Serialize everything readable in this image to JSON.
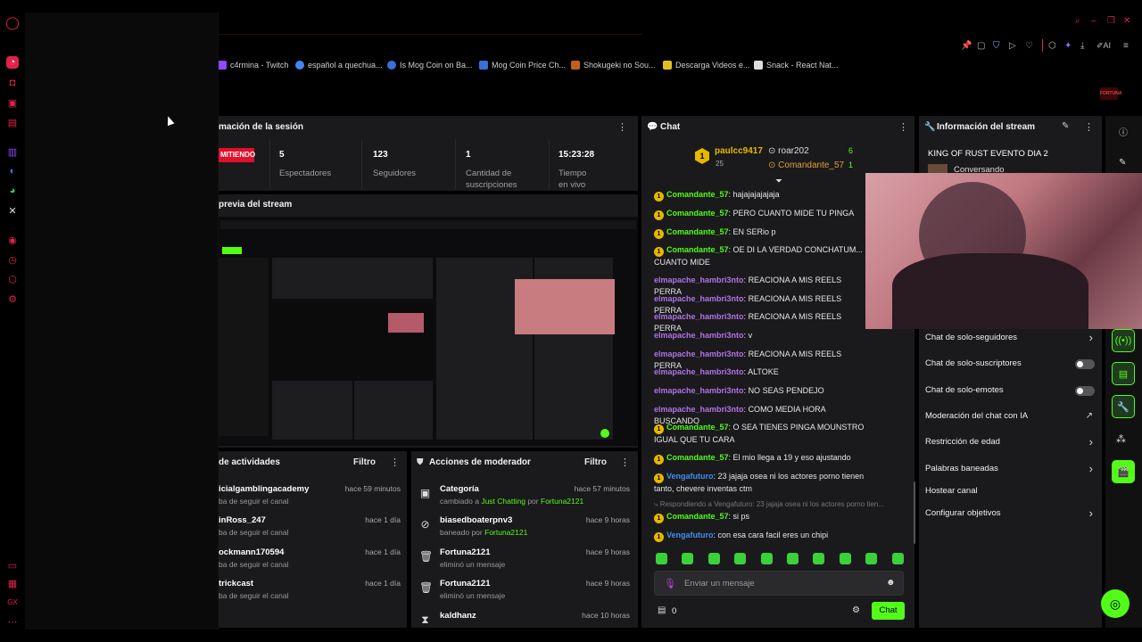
{
  "bookmarks": [
    {
      "label": "c4rmina - Twitch",
      "color": "#9146ff"
    },
    {
      "label": "español a quechua...",
      "color": "#4285f4"
    },
    {
      "label": "Is Mog Coin on Ba...",
      "color": "#3b6fd8"
    },
    {
      "label": "Mog Coin Price Ch...",
      "color": "#3b6fd8"
    },
    {
      "label": "Shokugeki no Sou...",
      "color": "#c06020"
    },
    {
      "label": "Descarga Videos e...",
      "color": "#e0c020"
    },
    {
      "label": "Snack - React Nat...",
      "color": "#dddddd"
    }
  ],
  "brand_badge": "FORTUNA",
  "session": {
    "title": "mación de la sesión",
    "live_badge": "MITIENDO",
    "stats": [
      {
        "value": "5",
        "label": "Espectadores"
      },
      {
        "value": "123",
        "label": "Seguidores"
      },
      {
        "value": "1",
        "label": "Cantidad de suscripciones"
      },
      {
        "value": "15:23:28",
        "label": "Tiempo en vivo"
      }
    ]
  },
  "preview": {
    "title": "previa del stream"
  },
  "activity": {
    "title": "de actividades",
    "filter": "Filtro",
    "rows": [
      {
        "name": "icialgamblingacademy",
        "sub": "ba de seguir el canal",
        "time": "hace 59 minutos"
      },
      {
        "name": "inRoss_247",
        "sub": "ba de seguir el canal",
        "time": "hace 1 día"
      },
      {
        "name": "ockmann170594",
        "sub": "ba de seguir el canal",
        "time": "hace 1 día"
      },
      {
        "name": "trickcast",
        "sub": "ba de seguir el canal",
        "time": "hace 1 día"
      }
    ]
  },
  "modactions": {
    "title": "Acciones de moderador",
    "filter": "Filtro",
    "rows": [
      {
        "icon": "category-icon",
        "name": "Categoría",
        "sub_pre": "cambiado a",
        "hl1": "Just Chatting",
        "mid": "por",
        "hl2": "Fortuna2121",
        "time": "hace 57 minutos"
      },
      {
        "icon": "ban-icon",
        "name": "biasedboaterpnv3",
        "sub_pre": "baneado por",
        "hl1": "Fortuna2121",
        "mid": "",
        "hl2": "",
        "time": "hace 9 horas"
      },
      {
        "icon": "trash-icon",
        "name": "Fortuna2121",
        "sub_pre": "eliminó un mensaje",
        "hl1": "",
        "mid": "",
        "hl2": "",
        "time": "hace 9 horas"
      },
      {
        "icon": "trash-icon",
        "name": "Fortuna2121",
        "sub_pre": "eliminó un mensaje",
        "hl1": "",
        "mid": "",
        "hl2": "",
        "time": "hace 9 horas"
      },
      {
        "icon": "hourglass-icon",
        "name": "kaldhanz",
        "sub_pre": "",
        "hl1": "",
        "mid": "",
        "hl2": "",
        "time": "hace 10 horas"
      }
    ]
  },
  "chat": {
    "title": "Chat",
    "leaderboard": {
      "first": {
        "rank": "1",
        "name": "paulcc9417",
        "count": "25"
      },
      "others": [
        {
          "name": "roar202",
          "count": "6"
        },
        {
          "name": "Comandante_57",
          "count": "1"
        }
      ]
    },
    "messages": [
      {
        "badge": true,
        "user": "Comandante_57",
        "color": "#53fc18",
        "text": "hajajajajajaja"
      },
      {
        "badge": true,
        "user": "Comandante_57",
        "color": "#53fc18",
        "text": "PERO CUANTO MIDE TU PINGA"
      },
      {
        "badge": true,
        "user": "Comandante_57",
        "color": "#53fc18",
        "text": "EN SERio p"
      },
      {
        "badge": true,
        "user": "Comandante_57",
        "color": "#53fc18",
        "text": "OE DI LA VERDAD CONCHATUM... CUANTO MIDE"
      },
      {
        "badge": false,
        "user": "elmapache_hambri3nto",
        "color": "#b072e8",
        "text": "REACIONA A MIS REELS PERRA"
      },
      {
        "badge": false,
        "user": "elmapache_hambri3nto",
        "color": "#b072e8",
        "text": "REACIONA A MIS REELS PERRA"
      },
      {
        "badge": false,
        "user": "elmapache_hambri3nto",
        "color": "#b072e8",
        "text": "REACIONA A MIS REELS PERRA"
      },
      {
        "badge": false,
        "user": "elmapache_hambri3nto",
        "color": "#b072e8",
        "text": "v"
      },
      {
        "badge": false,
        "user": "elmapache_hambri3nto",
        "color": "#b072e8",
        "text": "REACIONA A MIS REELS PERRA"
      },
      {
        "badge": false,
        "user": "elmapache_hambri3nto",
        "color": "#b072e8",
        "text": "ALTOKE"
      },
      {
        "badge": false,
        "user": "elmapache_hambri3nto",
        "color": "#b072e8",
        "text": "NO SEAS PENDEJO"
      },
      {
        "badge": false,
        "user": "elmapache_hambri3nto",
        "color": "#b072e8",
        "text": "COMO MEDIA HORA BUSCANDO"
      },
      {
        "badge": true,
        "user": "Comandante_57",
        "color": "#53fc18",
        "text": "O SEA TIENES PINGA MOUNSTRO IGUAL QUE TU CARA"
      },
      {
        "badge": true,
        "user": "Comandante_57",
        "color": "#53fc18",
        "text": "El mio llega a 19 y eso ajustando"
      },
      {
        "badge": true,
        "user": "Vengafuturo",
        "color": "#3f8df0",
        "text": "23 jajaja osea ni los actores porno tienen tanto, chevere inventas ctm"
      },
      {
        "badge": true,
        "user": "Comandante_57",
        "color": "#53fc18",
        "text": "si ps"
      },
      {
        "badge": true,
        "user": "Vengafuturo",
        "color": "#3f8df0",
        "text": "con esa cara facil eres un chipi"
      }
    ],
    "reply_hint": "Respondiendo a Vengafuturo: 23 jajaja osea ni los actores porno tien...",
    "input_placeholder": "Enviar un mensaje",
    "points": "0",
    "send_label": "Chat"
  },
  "streaminfo": {
    "title": "Información del stream",
    "stream_title": "KING OF RUST EVENTO DIA 2",
    "category": "Conversando",
    "settings": [
      {
        "label": "Chat de solo-seguidores",
        "kind": "arrow"
      },
      {
        "label": "Chat de solo-suscriptores",
        "kind": "toggle"
      },
      {
        "label": "Chat de solo-emotes",
        "kind": "toggle"
      },
      {
        "label": "Moderación del chat con IA",
        "kind": "external"
      },
      {
        "label": "Restricción de edad",
        "kind": "arrow"
      },
      {
        "label": "Palabras baneadas",
        "kind": "arrow"
      },
      {
        "label": "Hostear canal",
        "kind": "none"
      },
      {
        "label": "Configurar objetivos",
        "kind": "arrow"
      }
    ]
  }
}
